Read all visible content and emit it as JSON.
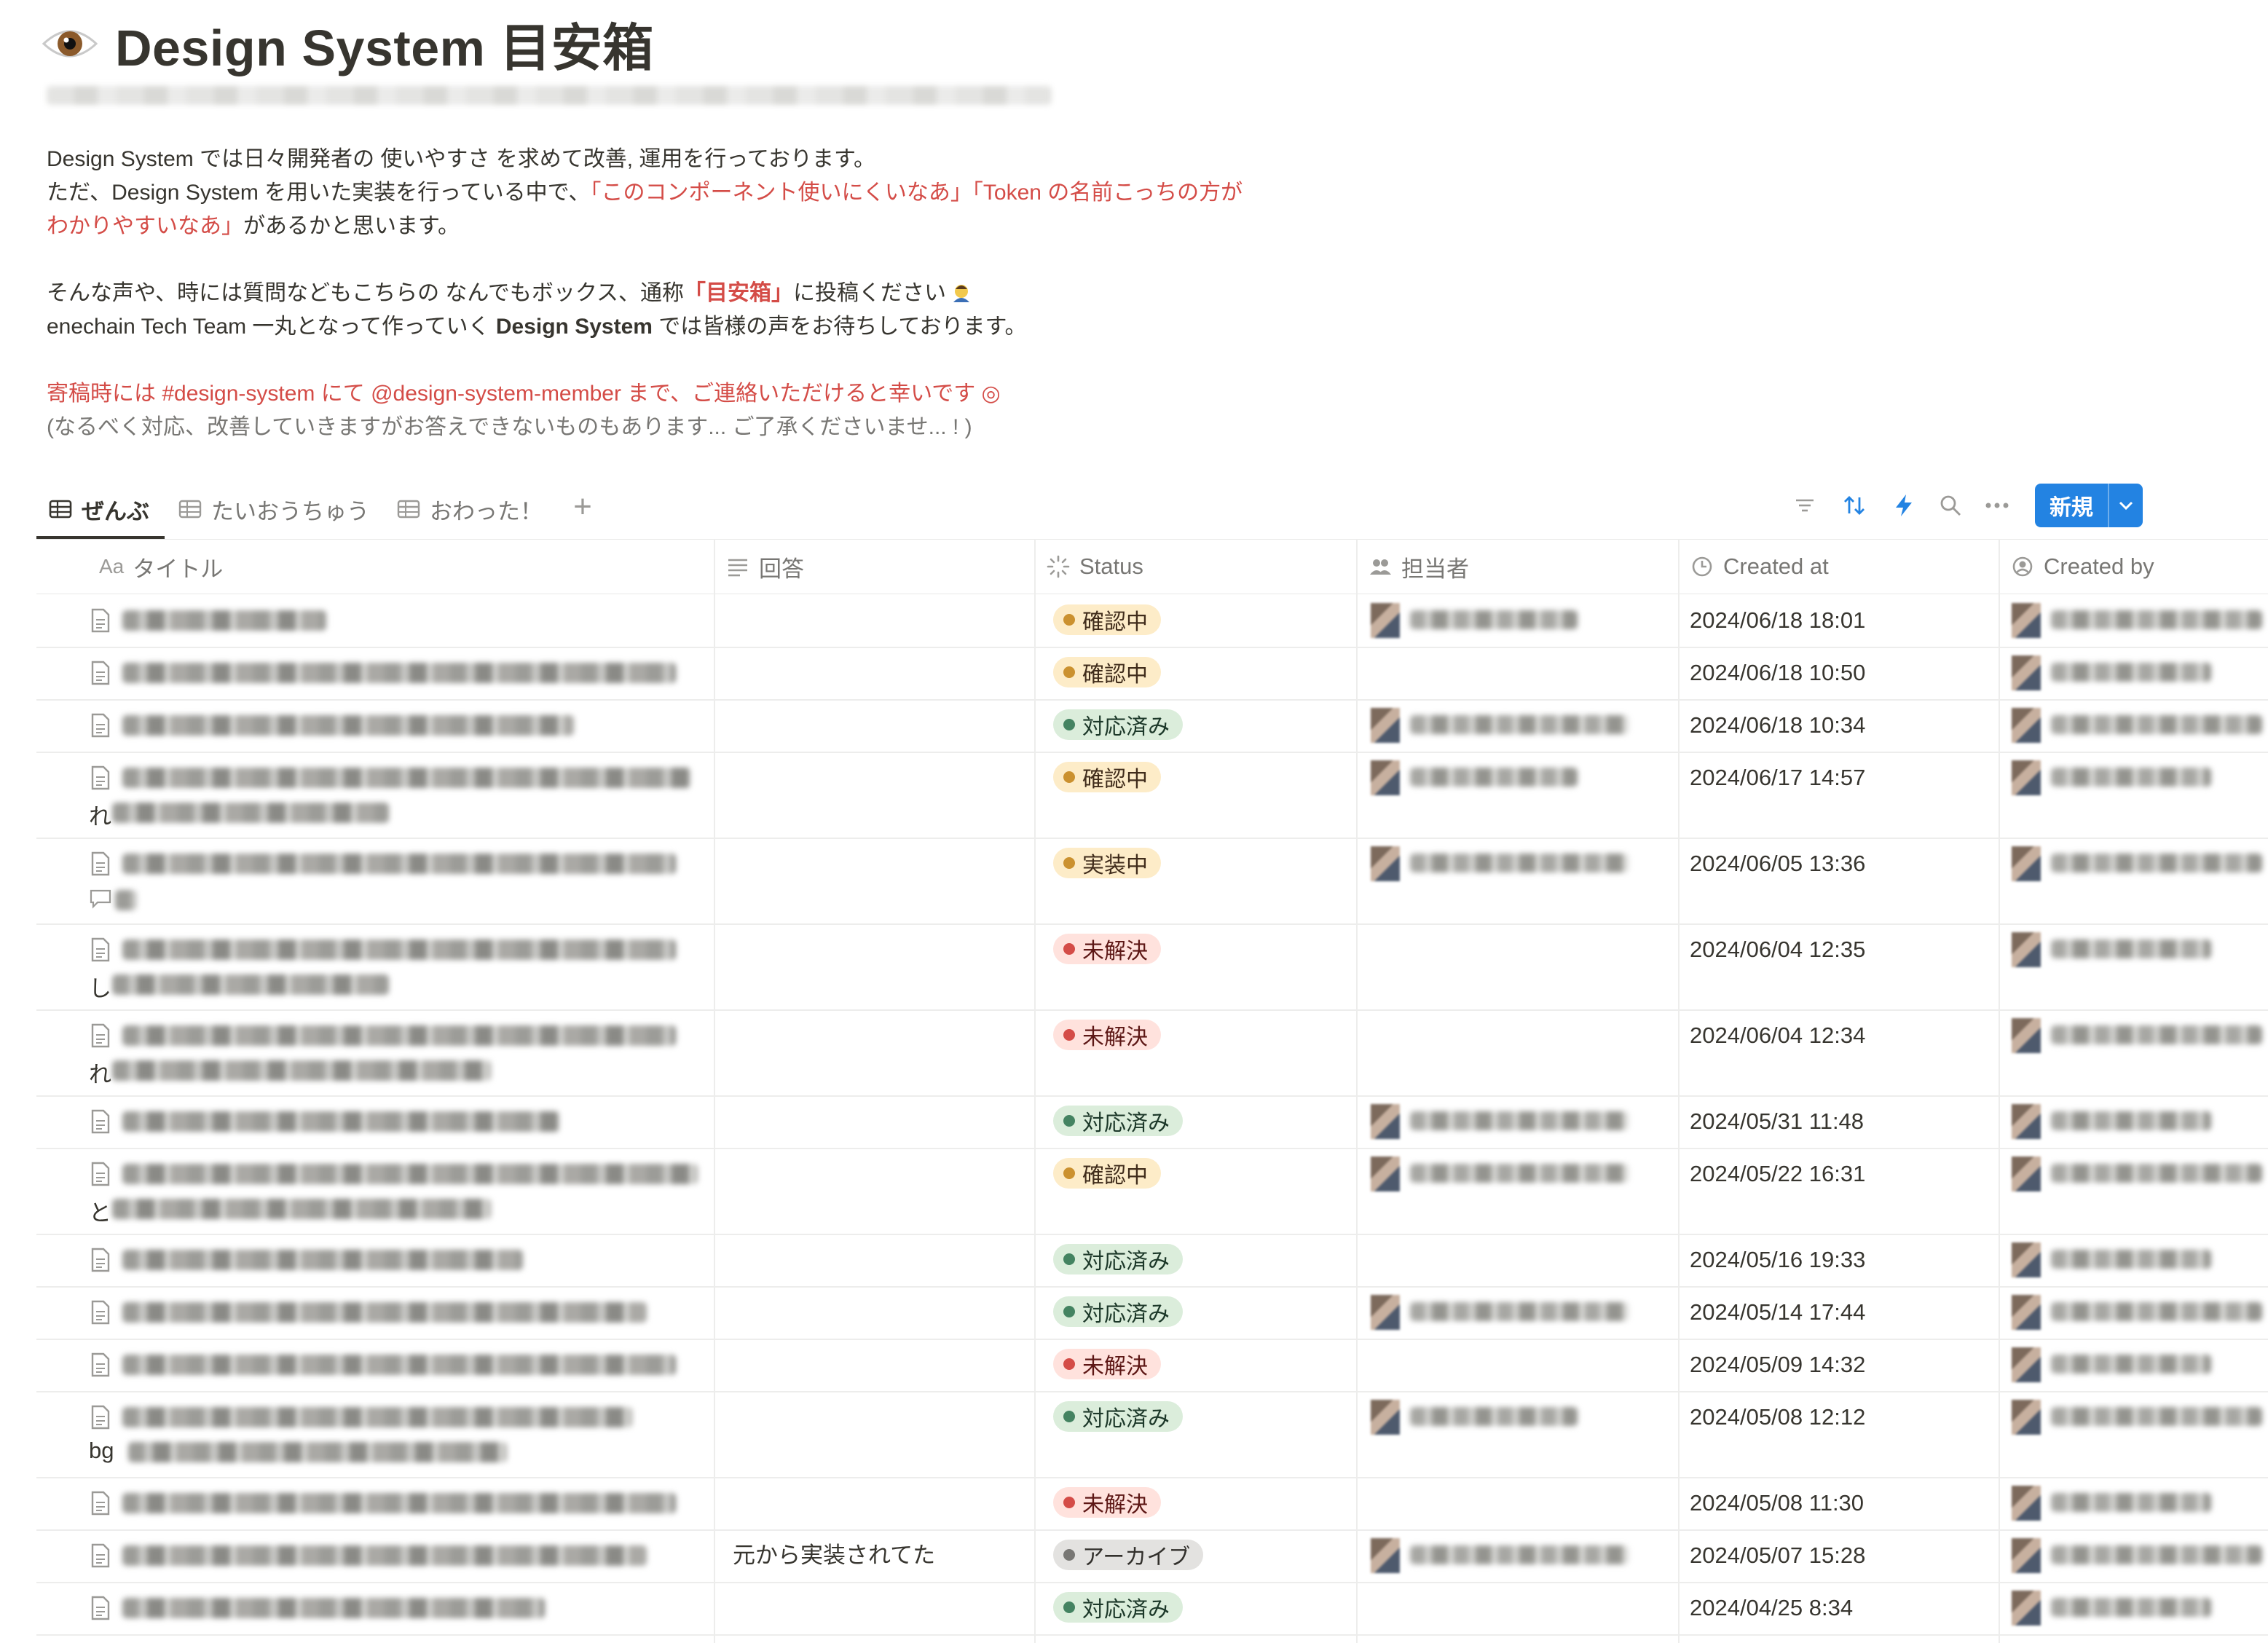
{
  "page": {
    "title": "Design System 目安箱",
    "title_icon": "eye-emoji-icon"
  },
  "description": {
    "line1": "Design System では日々開発者の 使いやすさ を求めて改善, 運用を行っております。",
    "line2_prefix": "ただ、Design System を用いた実装を行っている中で、",
    "line2_red": "「このコンポーネント使いにくいなあ」「Token の名前こっちの方が",
    "line3_red": "わかりやすいなあ」",
    "line3_suffix": "があるかと思います。",
    "line4_prefix": "そんな声や、時には質問などもこちらの なんでもボックス、通称",
    "line4_red_bold": "「目安箱」",
    "line4_suffix": "に投稿ください",
    "line5_prefix": "enechain Tech Team 一丸となって作っていく ",
    "line5_bold": "Design System",
    "line5_suffix": " では皆様の声をお待ちしております。",
    "line6_red": "寄稿時には #design-system にて @design-system-member まで、ご連絡いただけると幸いです ◎",
    "line7_grey": "(なるべく対応、改善していきますがお答えできないものもあります... ご了承くださいませ... ! )"
  },
  "tabs": [
    {
      "label": "ぜんぶ",
      "active": true
    },
    {
      "label": "たいおうちゅう",
      "active": false
    },
    {
      "label": "おわった！",
      "active": false
    }
  ],
  "toolbar": {
    "new_label": "新規",
    "accent": "#2383e2"
  },
  "columns": {
    "title": "タイトル",
    "title_prefix": "Aa",
    "answer": "回答",
    "status": "Status",
    "assignee": "担当者",
    "created_at": "Created at",
    "created_by": "Created by"
  },
  "status_colors": {
    "確認中": {
      "bg": "#fdecc8",
      "dot": "#cb912f",
      "fg": "#402c1b"
    },
    "対応済み": {
      "bg": "#dbeddb",
      "dot": "#448361",
      "fg": "#1c3829"
    },
    "実装中": {
      "bg": "#fdecc8",
      "dot": "#cb912f",
      "fg": "#402c1b"
    },
    "未解決": {
      "bg": "#ffe2dd",
      "dot": "#d44c47",
      "fg": "#5d1715"
    },
    "アーカイブ": {
      "bg": "#e3e2e0",
      "dot": "#787774",
      "fg": "#32302c"
    }
  },
  "rows": [
    {
      "wrap": "",
      "answer": "",
      "status": "確認中",
      "has_assignee": true,
      "created_at": "2024/06/18 18:01"
    },
    {
      "wrap": "",
      "answer": "",
      "status": "確認中",
      "has_assignee": false,
      "created_at": "2024/06/18 10:50"
    },
    {
      "wrap": "",
      "answer": "",
      "status": "対応済み",
      "has_assignee": true,
      "created_at": "2024/06/18 10:34"
    },
    {
      "wrap": "れ",
      "answer": "",
      "status": "確認中",
      "has_assignee": true,
      "created_at": "2024/06/17 14:57"
    },
    {
      "wrap": "",
      "answer": "",
      "status": "実装中",
      "has_assignee": true,
      "created_at": "2024/06/05 13:36",
      "comment": true
    },
    {
      "wrap": "し",
      "answer": "",
      "status": "未解決",
      "has_assignee": false,
      "created_at": "2024/06/04 12:35"
    },
    {
      "wrap": "れ",
      "answer": "",
      "status": "未解決",
      "has_assignee": false,
      "created_at": "2024/06/04 12:34"
    },
    {
      "wrap": "",
      "answer": "",
      "status": "対応済み",
      "has_assignee": true,
      "created_at": "2024/05/31 11:48"
    },
    {
      "wrap": "と",
      "answer": "",
      "status": "確認中",
      "has_assignee": true,
      "created_at": "2024/05/22 16:31"
    },
    {
      "wrap": "",
      "answer": "",
      "status": "対応済み",
      "has_assignee": false,
      "created_at": "2024/05/16 19:33"
    },
    {
      "wrap": "",
      "answer": "",
      "status": "対応済み",
      "has_assignee": true,
      "created_at": "2024/05/14 17:44"
    },
    {
      "wrap": "",
      "answer": "",
      "status": "未解決",
      "has_assignee": false,
      "created_at": "2024/05/09 14:32"
    },
    {
      "wrap": "bg",
      "answer": "",
      "status": "対応済み",
      "has_assignee": true,
      "created_at": "2024/05/08 12:12"
    },
    {
      "wrap": "",
      "answer": "",
      "status": "未解決",
      "has_assignee": false,
      "created_at": "2024/05/08 11:30"
    },
    {
      "wrap": "",
      "answer": "元から実装されてた",
      "status": "アーカイブ",
      "has_assignee": true,
      "created_at": "2024/05/07 15:28"
    },
    {
      "wrap": "",
      "answer": "",
      "status": "対応済み",
      "has_assignee": false,
      "created_at": "2024/04/25 8:34"
    }
  ]
}
